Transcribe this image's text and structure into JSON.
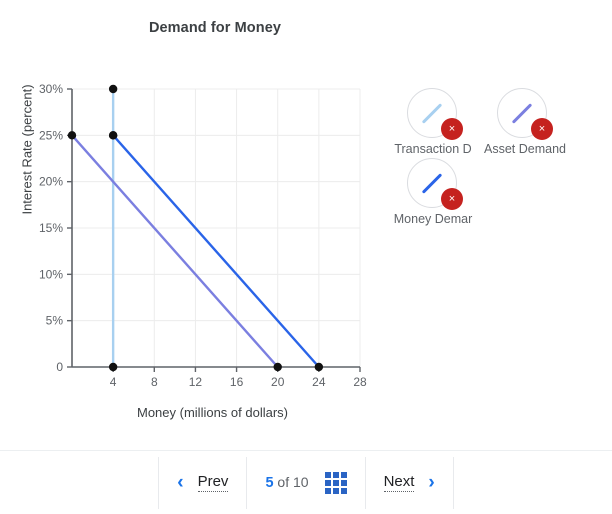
{
  "chart_data": {
    "type": "line",
    "title": "Demand for Money",
    "xlabel": "Money (millions of dollars)",
    "ylabel": "Interest Rate (percent)",
    "xlim": [
      0,
      28
    ],
    "ylim": [
      0,
      30
    ],
    "xticks": [
      "4",
      "8",
      "12",
      "16",
      "20",
      "24",
      "28"
    ],
    "xtick_values": [
      4,
      8,
      12,
      16,
      20,
      24,
      28
    ],
    "yticks": [
      "0",
      "5%",
      "10%",
      "15%",
      "20%",
      "25%",
      "30%"
    ],
    "ytick_values": [
      0,
      5,
      10,
      15,
      20,
      25,
      30
    ],
    "grid": true,
    "legend_position": "right",
    "series": [
      {
        "name": "Transaction Demand",
        "color": "#a8d0f0",
        "points": [
          [
            4,
            0
          ],
          [
            4,
            30
          ]
        ],
        "markers": [
          [
            4,
            0
          ],
          [
            4,
            25
          ],
          [
            4,
            30
          ]
        ]
      },
      {
        "name": "Asset Demand",
        "color": "#7b7fe0",
        "points": [
          [
            0,
            25
          ],
          [
            20,
            0
          ]
        ],
        "markers": [
          [
            0,
            25
          ],
          [
            20,
            0
          ]
        ]
      },
      {
        "name": "Money Demand",
        "color": "#2a64e8",
        "points": [
          [
            4,
            25
          ],
          [
            24,
            0
          ]
        ],
        "markers": [
          [
            4,
            25
          ],
          [
            24,
            0
          ]
        ]
      }
    ]
  },
  "legend": {
    "items": [
      {
        "label": "Transaction D",
        "color": "#a8d0f0",
        "remove_glyph": "×"
      },
      {
        "label": "Asset Demand",
        "color": "#7b7fe0",
        "remove_glyph": "×"
      },
      {
        "label": "Money Demar",
        "color": "#2a64e8",
        "remove_glyph": "×"
      }
    ]
  },
  "nav": {
    "prev_label": "Prev",
    "next_label": "Next",
    "prev_chevron": "‹",
    "next_chevron": "›",
    "current_page": "5",
    "of_label": "of",
    "total_pages": "10"
  },
  "colors": {
    "accent": "#1a73e8",
    "remove_badge": "#c5221f",
    "axis": "#5f6368",
    "grid": "#ececec",
    "text": "#3c4043"
  }
}
